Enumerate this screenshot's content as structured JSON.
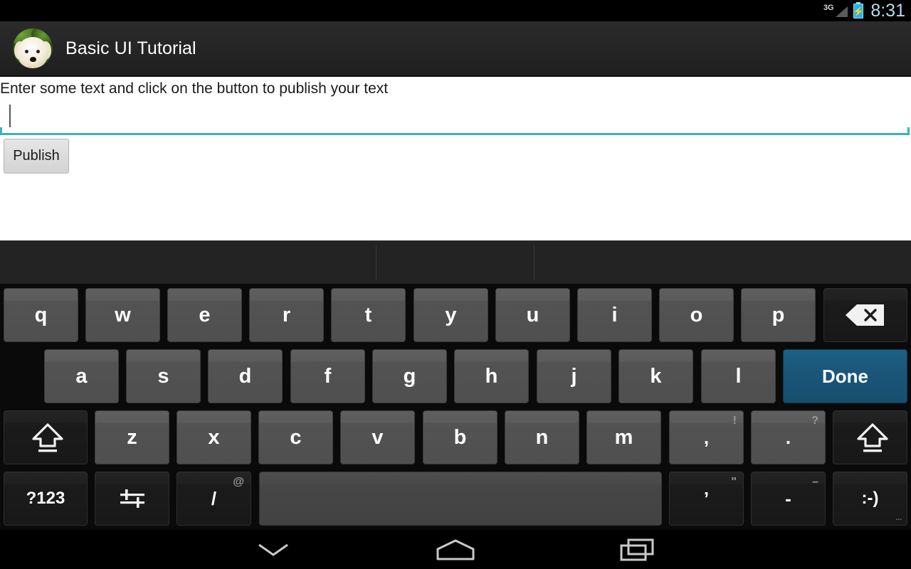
{
  "status_bar": {
    "network_label": "3G",
    "signal_icon": "signal-bars-icon",
    "battery_icon": "battery-charging-icon",
    "time": "8:31",
    "clock_color": "#b9d9ec",
    "battery_color": "#25b4e8"
  },
  "action_bar": {
    "avatar_icon": "dog-avatar-icon",
    "title": "Basic UI Tutorial",
    "background_color": "#252525"
  },
  "content": {
    "prompt": "Enter some text and click on the button to publish your text",
    "input_value": "",
    "input_placeholder": "",
    "input_focus_color": "#3ab0c4",
    "publish_label": "Publish"
  },
  "keyboard": {
    "suggestions": [
      "",
      "",
      ""
    ],
    "row1": [
      {
        "label": "q",
        "type": "letter"
      },
      {
        "label": "w",
        "type": "letter"
      },
      {
        "label": "e",
        "type": "letter"
      },
      {
        "label": "r",
        "type": "letter"
      },
      {
        "label": "t",
        "type": "letter"
      },
      {
        "label": "y",
        "type": "letter"
      },
      {
        "label": "u",
        "type": "letter"
      },
      {
        "label": "i",
        "type": "letter"
      },
      {
        "label": "o",
        "type": "letter"
      },
      {
        "label": "p",
        "type": "letter"
      }
    ],
    "backspace_icon": "backspace-icon",
    "row2": [
      {
        "label": "a",
        "type": "letter"
      },
      {
        "label": "s",
        "type": "letter"
      },
      {
        "label": "d",
        "type": "letter"
      },
      {
        "label": "f",
        "type": "letter"
      },
      {
        "label": "g",
        "type": "letter"
      },
      {
        "label": "h",
        "type": "letter"
      },
      {
        "label": "j",
        "type": "letter"
      },
      {
        "label": "k",
        "type": "letter"
      },
      {
        "label": "l",
        "type": "letter"
      }
    ],
    "done_label": "Done",
    "done_color": "#1b587c",
    "shift_icon": "shift-icon",
    "row3": [
      {
        "label": "z",
        "type": "letter"
      },
      {
        "label": "x",
        "type": "letter"
      },
      {
        "label": "c",
        "type": "letter"
      },
      {
        "label": "v",
        "type": "letter"
      },
      {
        "label": "b",
        "type": "letter"
      },
      {
        "label": "n",
        "type": "letter"
      },
      {
        "label": "m",
        "type": "letter"
      }
    ],
    "comma_key": {
      "label": ",",
      "hint": "!"
    },
    "period_key": {
      "label": ".",
      "hint": "?"
    },
    "symbols_label": "?123",
    "settings_icon": "keyboard-settings-icon",
    "slash_key": {
      "label": "/",
      "hint": "@"
    },
    "space_label": "",
    "apostrophe_key": {
      "label": "’",
      "hint": "\""
    },
    "hyphen_key": {
      "label": "-",
      "hint": "–"
    },
    "emoji_key": {
      "label": ":-)",
      "hint": "..."
    }
  },
  "nav_bar": {
    "back_icon": "hide-keyboard-chevron-icon",
    "home_icon": "home-icon",
    "recents_icon": "recent-apps-icon"
  }
}
